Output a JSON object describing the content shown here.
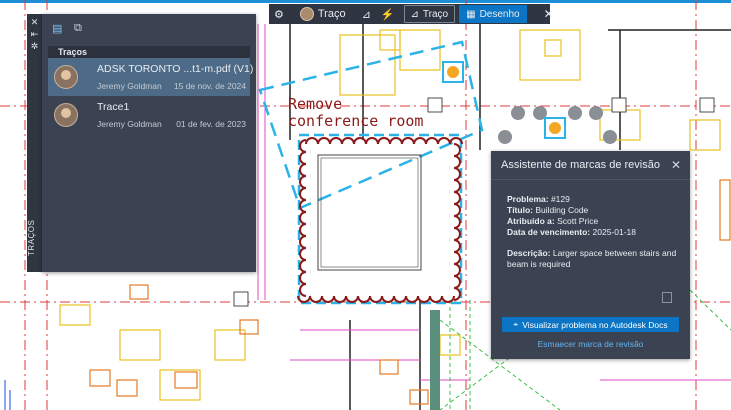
{
  "toolbar": {
    "user_label": "Traço",
    "trace_button": "Traço",
    "drawing_button": "Desenho"
  },
  "drawing": {
    "annotation_line1": "Remove",
    "annotation_line2": "conference room"
  },
  "traces_panel": {
    "side_label": "TRAÇOS",
    "section_title": "Traços",
    "items": [
      {
        "title": "ADSK TORONTO ...t1-m.pdf (V1)",
        "author": "Jeremy Goldman",
        "date": "15 de nov. de 2024"
      },
      {
        "title": "Trace1",
        "author": "Jeremy Goldman",
        "date": "01 de fev. de 2023"
      }
    ]
  },
  "assistant": {
    "title": "Assistente de marcas de revisão",
    "fields": [
      {
        "label": "Problema:",
        "value": "#129"
      },
      {
        "label": "Título:",
        "value": "Building Code"
      },
      {
        "label": "Atribuído a:",
        "value": "Scott Price"
      },
      {
        "label": "Data de vencimento:",
        "value": "2025-01-18"
      }
    ],
    "description_label": "Descrição:",
    "description_value": "Larger space between stairs and beam is required",
    "primary_action": "Visualizar problema no Autodesk Docs",
    "secondary_action": "Esmaecer marca de revisão"
  },
  "colors": {
    "panel_bg": "#3b4352",
    "accent_blue": "#0b74c4",
    "markup_cyan": "#2ab3e6",
    "markup_red": "#8b1a1a"
  }
}
